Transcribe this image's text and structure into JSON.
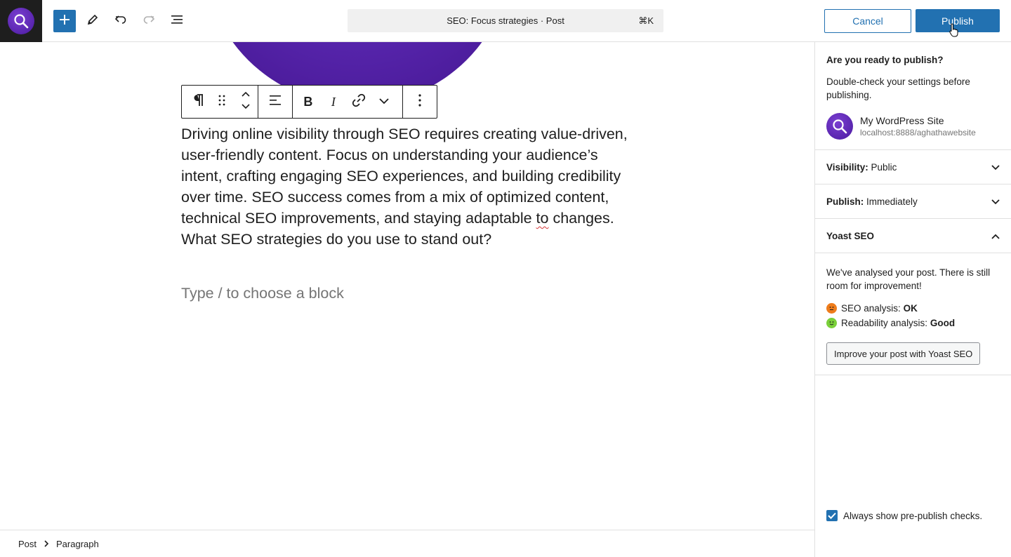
{
  "header": {
    "command_title": "SEO: Focus strategies · Post",
    "command_shortcut": "⌘K",
    "cancel_label": "Cancel",
    "publish_label": "Publish",
    "icons": [
      "site-logo-icon",
      "plus-icon",
      "pencil-icon",
      "undo-icon",
      "redo-icon",
      "document-overview-icon"
    ]
  },
  "block_toolbar": {
    "icons": [
      "paragraph-icon",
      "drag-handle-icon",
      "move-up-down-icon",
      "align-icon",
      "bold-icon",
      "italic-icon",
      "link-icon",
      "chevron-down-icon",
      "more-options-icon"
    ]
  },
  "editor": {
    "paragraph_before": "Driving online visibility through SEO requires creating value-driven, user-friendly content. Focus on understanding your audience’s intent, crafting engaging SEO experiences, and building credibility over time. SEO success comes from a mix of optimized content, technical SEO improvements, and staying adaptable ",
    "paragraph_misspelled": "to",
    "paragraph_after": " changes. What SEO strategies do you use to stand out?",
    "placeholder": "Type / to choose a block"
  },
  "breadcrumb": {
    "items": [
      "Post",
      "Paragraph"
    ]
  },
  "sidebar": {
    "heading": "Are you ready to publish?",
    "description": "Double-check your settings before publishing.",
    "site_name": "My WordPress Site",
    "site_url": "localhost:8888/aghathawebsite",
    "visibility_label": "Visibility:",
    "visibility_value": "Public",
    "publish_label": "Publish:",
    "publish_value": "Immediately",
    "yoast_title": "Yoast SEO",
    "yoast_message": "We've analysed your post. There is still room for improvement!",
    "seo_analysis_label": "SEO analysis:",
    "seo_analysis_value": "OK",
    "readability_label": "Readability analysis:",
    "readability_value": "Good",
    "improve_button": "Improve your post with Yoast SEO",
    "always_show_label": "Always show pre-publish checks.",
    "always_show_checked": true
  },
  "colors": {
    "accent": "#2271b1",
    "seo_ok": "#ee7c1b",
    "readability_good": "#7ad03a",
    "featured_image": "#5b2bb5"
  }
}
